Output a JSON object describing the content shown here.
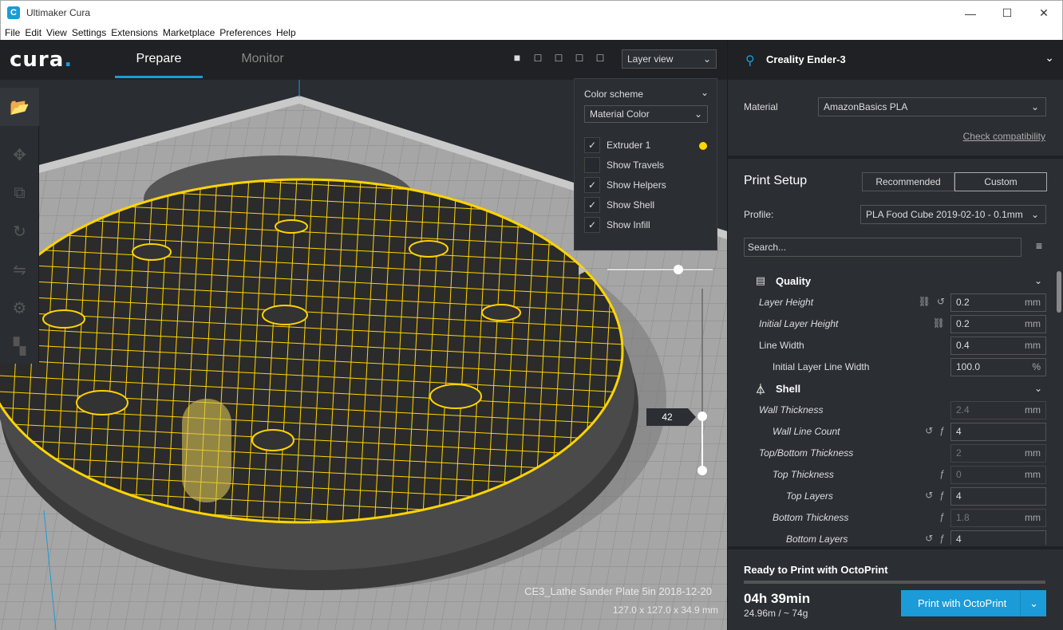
{
  "window": {
    "title": "Ultimaker Cura",
    "app_icon": "C",
    "minimize": "—",
    "maximize": "☐",
    "close": "✕"
  },
  "menu": [
    "File",
    "Edit",
    "View",
    "Settings",
    "Extensions",
    "Marketplace",
    "Preferences",
    "Help"
  ],
  "header": {
    "logo": "cura",
    "logo_dot": ".",
    "tabs": [
      "Prepare",
      "Monitor"
    ],
    "view_mode": "Layer view"
  },
  "color_panel": {
    "label": "Color scheme",
    "scheme": "Material Color",
    "options": [
      {
        "label": "Extruder 1",
        "checked": true
      },
      {
        "label": "Show Travels",
        "checked": false
      },
      {
        "label": "Show Helpers",
        "checked": true
      },
      {
        "label": "Show Shell",
        "checked": true
      },
      {
        "label": "Show Infill",
        "checked": true
      }
    ],
    "extruder_color": "#ffd400"
  },
  "layer_slider": {
    "current": "42"
  },
  "model": {
    "name": "CE3_Lathe Sander Plate 5in 2018-12-20",
    "dims": "127.0 x 127.0 x 34.9 mm"
  },
  "printer": {
    "name": "Creality Ender-3",
    "material_label": "Material",
    "material": "AmazonBasics PLA",
    "check_compat": "Check compatibility"
  },
  "print_setup": {
    "title": "Print Setup",
    "modes": [
      "Recommended",
      "Custom"
    ],
    "profile_label": "Profile:",
    "profile": "PLA Food Cube 2019-02-10 - 0.1mm",
    "search_placeholder": "Search..."
  },
  "categories": {
    "quality": "Quality",
    "shell": "Shell"
  },
  "settings": [
    {
      "label": "Layer Height",
      "value": "0.2",
      "unit": "mm"
    },
    {
      "label": "Initial Layer Height",
      "value": "0.2",
      "unit": "mm"
    },
    {
      "label": "Line Width",
      "value": "0.4",
      "unit": "mm"
    },
    {
      "label": "Initial Layer Line Width",
      "value": "100.0",
      "unit": "%"
    },
    {
      "label": "Wall Thickness",
      "value": "2.4",
      "unit": "mm"
    },
    {
      "label": "Wall Line Count",
      "value": "4",
      "unit": ""
    },
    {
      "label": "Top/Bottom Thickness",
      "value": "2",
      "unit": "mm"
    },
    {
      "label": "Top Thickness",
      "value": "0",
      "unit": "mm"
    },
    {
      "label": "Top Layers",
      "value": "4",
      "unit": ""
    },
    {
      "label": "Bottom Thickness",
      "value": "1.8",
      "unit": "mm"
    },
    {
      "label": "Bottom Layers",
      "value": "4",
      "unit": ""
    }
  ],
  "output": {
    "ready": "Ready to Print with OctoPrint",
    "time": "04h 39min",
    "material": "24.96m / ~ 74g",
    "button": "Print with OctoPrint"
  },
  "colors": {
    "accent": "#1b9bd8",
    "infill": "#ffd400"
  }
}
